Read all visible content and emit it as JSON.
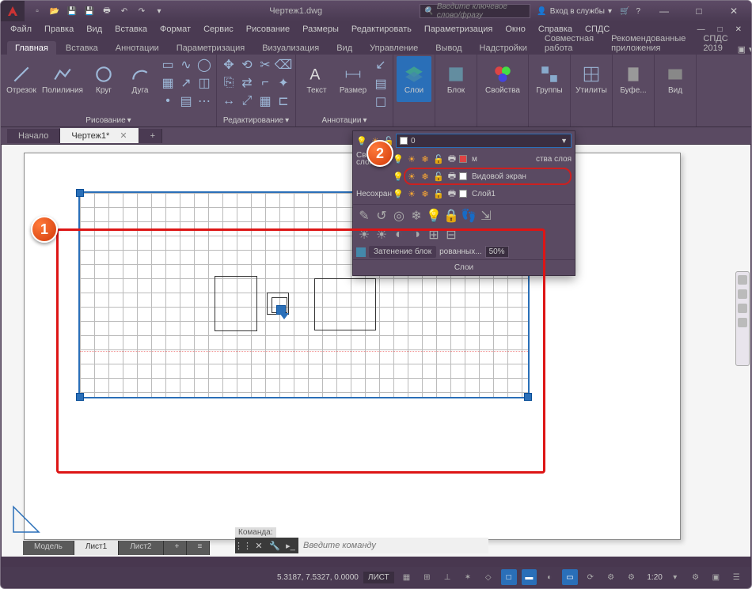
{
  "title": "Чертеж1.dwg",
  "search_placeholder": "Введите ключевое слово/фразу",
  "login_label": "Вход в службы",
  "menus": [
    "Файл",
    "Правка",
    "Вид",
    "Вставка",
    "Формат",
    "Сервис",
    "Рисование",
    "Размеры",
    "Редактировать",
    "Параметризация",
    "Окно",
    "Справка",
    "СПДС"
  ],
  "ribbon_tabs": [
    "Главная",
    "Вставка",
    "Аннотации",
    "Параметризация",
    "Визуализация",
    "Вид",
    "Управление",
    "Вывод",
    "Надстройки",
    "Совместная работа",
    "Рекомендованные приложения",
    "СПДС 2019"
  ],
  "active_ribbon_tab": "Главная",
  "panels": {
    "draw": {
      "title": "Рисование",
      "items": [
        "Отрезок",
        "Полилиния",
        "Круг",
        "Дуга"
      ]
    },
    "edit": {
      "title": "Редактирование"
    },
    "annot": {
      "title": "Аннотации",
      "items": [
        "Текст",
        "Размер"
      ]
    },
    "layers": {
      "title": "Слои"
    },
    "block": {
      "title": "Блок"
    },
    "props": {
      "title": "Свойства"
    },
    "groups": {
      "title": "Группы"
    },
    "util": {
      "title": "Утилиты"
    },
    "clip": {
      "title": "Буфе..."
    },
    "view": {
      "title": "Вид"
    }
  },
  "doc_tabs": {
    "start": "Начало",
    "current": "Чертеж1*"
  },
  "layer_panel": {
    "combo_value": "0",
    "left1": "Сво\nслоя",
    "right1": "м",
    "right1b": "ства слоя",
    "left2": "Несохран",
    "row_viewport": "Видовой экран",
    "row_layer1": "Слой1",
    "shade_label": "Затенение блок",
    "shade_suffix": "рованных...",
    "shade_value": "50%",
    "footer": "Слои"
  },
  "model_tabs": [
    "Модель",
    "Лист1",
    "Лист2"
  ],
  "active_model_tab": "Лист1",
  "cmd_label": "Команда:",
  "cmd_placeholder": "Введите команду",
  "status": {
    "coords": "5.3187, 7.5327, 0.0000",
    "space": "ЛИСТ",
    "zoom": "1:20"
  },
  "callouts": {
    "one": "1",
    "two": "2"
  }
}
